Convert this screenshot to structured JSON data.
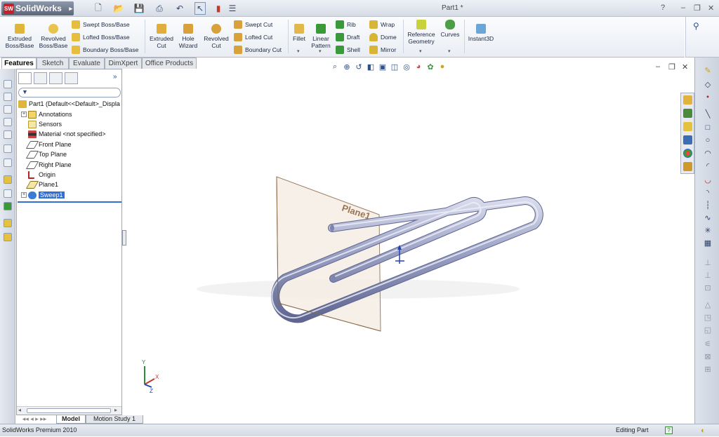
{
  "app": {
    "name": "SolidWorks",
    "window_title": "Part1 *",
    "help_label": "?"
  },
  "ribbon": {
    "items": [
      {
        "label1": "Extruded",
        "label2": "Boss/Base"
      },
      {
        "label1": "Revolved",
        "label2": "Boss/Base"
      },
      {
        "label1": "Extruded",
        "label2": "Cut"
      },
      {
        "label1": "Hole",
        "label2": "Wizard"
      },
      {
        "label1": "Revolved",
        "label2": "Cut"
      },
      {
        "label1": "Fillet",
        "label2": ""
      },
      {
        "label1": "Linear",
        "label2": "Pattern"
      },
      {
        "label1": "Reference",
        "label2": "Geometry"
      },
      {
        "label1": "Curves",
        "label2": ""
      },
      {
        "label1": "Instant3D",
        "label2": ""
      }
    ],
    "small": {
      "swept_boss": "Swept Boss/Base",
      "lofted_boss": "Lofted Boss/Base",
      "boundary_boss": "Boundary Boss/Base",
      "swept_cut": "Swept Cut",
      "lofted_cut": "Lofted Cut",
      "boundary_cut": "Boundary Cut",
      "rib": "Rib",
      "draft": "Draft",
      "shell": "Shell",
      "wrap": "Wrap",
      "dome": "Dome",
      "mirror": "Mirror"
    }
  },
  "tabs": [
    "Features",
    "Sketch",
    "Evaluate",
    "DimXpert",
    "Office Products"
  ],
  "tree": {
    "root": "Part1  (Default<<Default>_Displa",
    "nodes": [
      "Annotations",
      "Sensors",
      "Material <not specified>",
      "Front Plane",
      "Top Plane",
      "Right Plane",
      "Origin",
      "Plane1",
      "Sweep1"
    ],
    "expand_mark": "+"
  },
  "viewport": {
    "plane_label": "Plane1",
    "axis_y": "Y",
    "axis_x": "X",
    "axis_z": "Z"
  },
  "bottom_tabs": [
    "Model",
    "Motion Study 1"
  ],
  "status": {
    "left": "SolidWorks Premium 2010",
    "mode": "Editing Part",
    "help": "?"
  },
  "colors": {
    "brand": "#c8202a",
    "selection": "#2f6fd6",
    "plane_edge": "#8b6b4a",
    "plane_fill": "#f3e9df",
    "tube": "#8d92b8"
  }
}
